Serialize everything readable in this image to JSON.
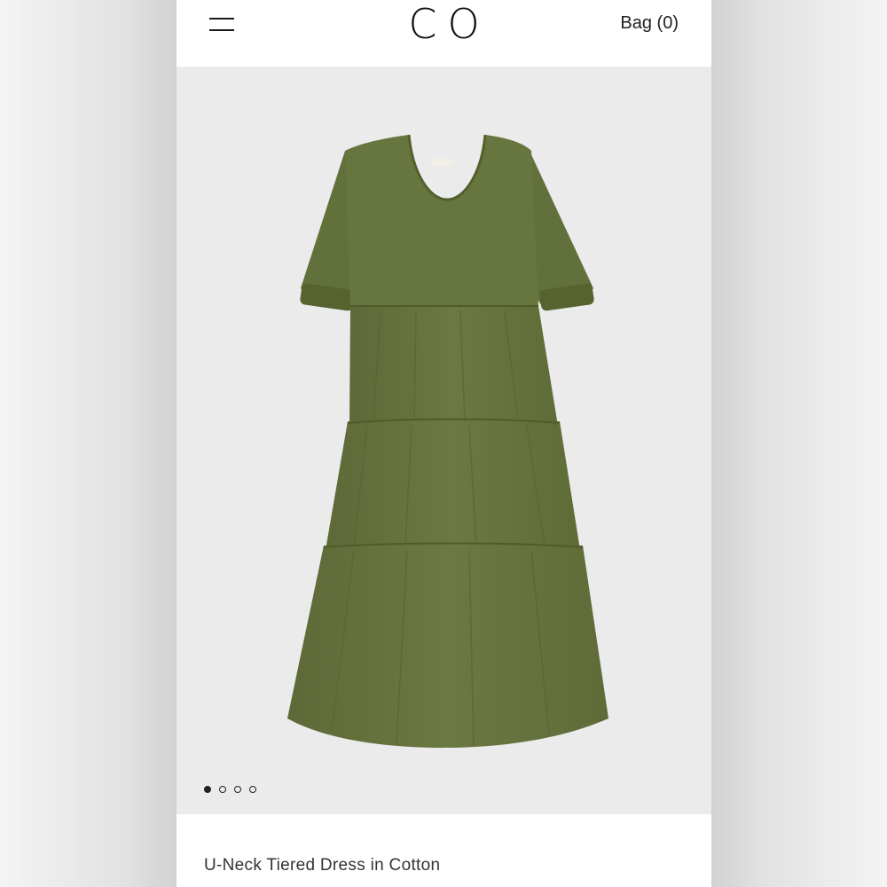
{
  "header": {
    "logo": "CO",
    "bag_label": "Bag (0)"
  },
  "gallery": {
    "image": "olive green u-neck tiered midi dress with puff sleeves",
    "dress_color": "#66733f",
    "slide_count": 4,
    "active_slide": 1
  },
  "product": {
    "title": "U-Neck Tiered Dress in Cotton"
  }
}
